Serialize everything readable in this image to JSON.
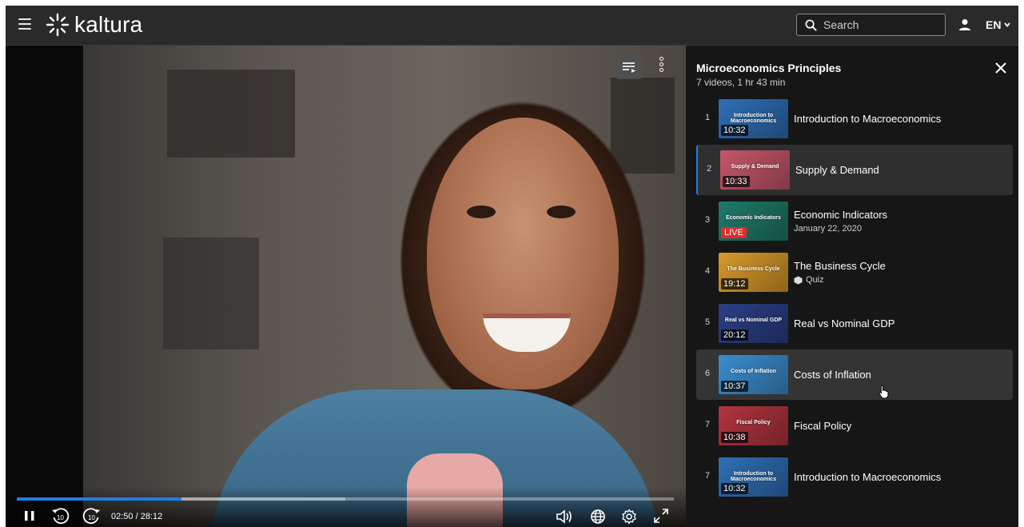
{
  "header": {
    "brand": "kaltura",
    "search_placeholder": "Search",
    "language": "EN"
  },
  "player": {
    "time_display": "02:50 / 28:12",
    "progress_fraction": 0.25,
    "buffer_fraction": 0.5,
    "skip_back_label": "10",
    "skip_forward_label": "10"
  },
  "playlist": {
    "title": "Microeconomics Principles",
    "meta": "7 videos, 1 hr 43 min",
    "items": [
      {
        "number": "1",
        "title": "Introduction to Macroeconomics",
        "thumb_label": "Introduction to Macroeconomics",
        "duration": "10:32",
        "subtitle": "",
        "thumb_color": "#2f6fb6"
      },
      {
        "number": "2",
        "title": "Supply & Demand",
        "thumb_label": "Supply & Demand",
        "duration": "10:33",
        "subtitle": "",
        "thumb_color": "#c6576b"
      },
      {
        "number": "3",
        "title": "Economic Indicators",
        "thumb_label": "Economic Indicators",
        "duration": "",
        "live": "LIVE",
        "subtitle": "January 22, 2020",
        "thumb_color": "#1f7a6a"
      },
      {
        "number": "4",
        "title": "The Business Cycle",
        "thumb_label": "The Business Cycle",
        "duration": "19:12",
        "subtitle": "Quiz",
        "thumb_color": "#d89a2a"
      },
      {
        "number": "5",
        "title": "Real vs Nominal GDP",
        "thumb_label": "Real vs Nominal GDP",
        "duration": "20:12",
        "subtitle": "",
        "thumb_color": "#2b3f86"
      },
      {
        "number": "6",
        "title": "Costs of Inflation",
        "thumb_label": "Costs of Inflation",
        "duration": "10:37",
        "subtitle": "",
        "thumb_color": "#3b8ecf"
      },
      {
        "number": "7",
        "title": "Fiscal Policy",
        "thumb_label": "Fiscal Policy",
        "duration": "10:38",
        "subtitle": "",
        "thumb_color": "#b2343f"
      },
      {
        "number": "7",
        "title": "Introduction to Macroeconomics",
        "thumb_label": "Introduction to Macroeconomics",
        "duration": "10:32",
        "subtitle": "",
        "thumb_color": "#2f6fb6"
      }
    ]
  },
  "colors": {
    "accent": "#1b7fe6",
    "header_bg": "#2a2a2a",
    "live_badge": "#e02b2b"
  },
  "icons": {
    "menu": "hamburger-icon",
    "search": "search-icon",
    "user": "user-icon",
    "playlist": "playlist-icon",
    "more": "more-vertical-icon",
    "close": "close-icon",
    "pause": "pause-icon",
    "rewind": "rewind-10-icon",
    "forward": "forward-10-icon",
    "volume": "volume-icon",
    "captions": "globe-icon",
    "settings": "gear-icon",
    "fullscreen": "fullscreen-icon",
    "quiz": "quiz-cube-icon"
  }
}
